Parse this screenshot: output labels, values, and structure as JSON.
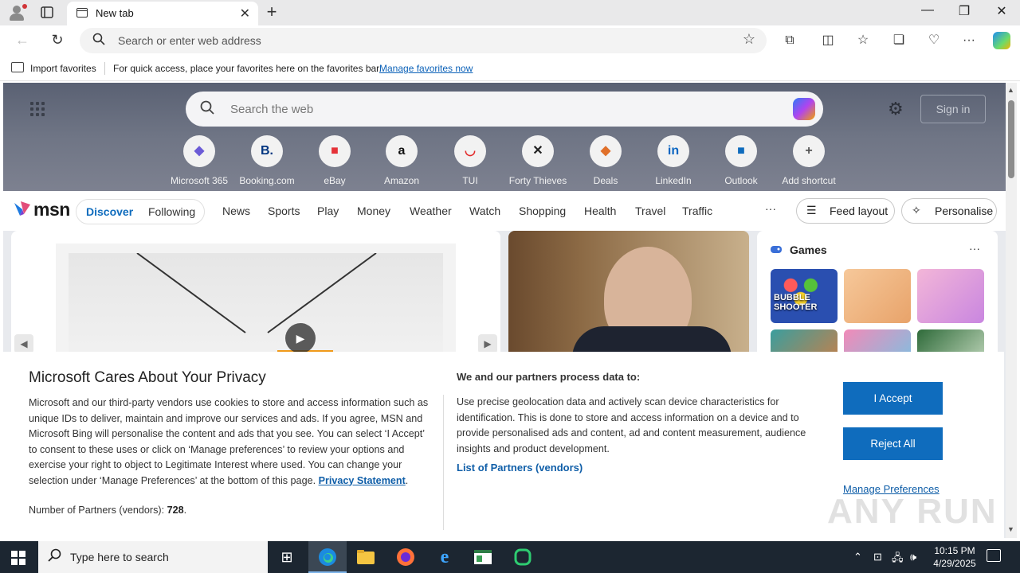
{
  "browser": {
    "tab_title": "New tab",
    "address_placeholder": "Search or enter web address",
    "favorites": {
      "import_label": "Import favorites",
      "message": "For quick access, place your favorites here on the favorites bar.",
      "manage_link": "Manage favorites now"
    }
  },
  "newtab": {
    "search_placeholder": "Search the web",
    "signin_label": "Sign in",
    "shortcuts": [
      {
        "label": "Microsoft 365",
        "icon": "microsoft-365-icon",
        "color": "#6b5bd6"
      },
      {
        "label": "Booking.com",
        "icon": "booking-icon",
        "color": "#003580"
      },
      {
        "label": "eBay",
        "icon": "ebay-icon",
        "color": "#e53238"
      },
      {
        "label": "Amazon",
        "icon": "amazon-icon",
        "color": "#111111"
      },
      {
        "label": "TUI",
        "icon": "tui-icon",
        "color": "#e32929"
      },
      {
        "label": "Forty Thieves",
        "icon": "forty-thieves-icon",
        "color": "#222222"
      },
      {
        "label": "Deals",
        "icon": "deals-icon",
        "color": "#e0702a"
      },
      {
        "label": "LinkedIn",
        "icon": "linkedin-icon",
        "color": "#0a66c2"
      },
      {
        "label": "Outlook",
        "icon": "outlook-icon",
        "color": "#0f6cbd"
      },
      {
        "label": "Add shortcut",
        "icon": "plus-icon",
        "color": "#555555"
      }
    ]
  },
  "msn": {
    "logo": "msn",
    "tabs": {
      "discover": "Discover",
      "following": "Following"
    },
    "categories": [
      "News",
      "Sports",
      "Play",
      "Money",
      "Weather",
      "Watch",
      "Shopping",
      "Health",
      "Travel",
      "Traffic"
    ],
    "more": "···",
    "feed_layout": "Feed layout",
    "personalise": "Personalise",
    "games": {
      "title": "Games",
      "more": "···",
      "tile_text": "BUBBLE SHOOTER"
    }
  },
  "privacy": {
    "title": "Microsoft Cares About Your Privacy",
    "body": "Microsoft and our third-party vendors use cookies to store and access information such as unique IDs to deliver, maintain and improve our services and ads. If you agree, MSN and Microsoft Bing will personalise the content and ads that you see. You can select ‘I Accept’ to consent to these uses or click on ‘Manage preferences’ to review your options and exercise your right to object to Legitimate Interest where used.  You can change your selection under ‘Manage Preferences’ at the bottom of this page.",
    "privacy_link": "Privacy Statement",
    "partners_label": "Number of Partners (vendors): ",
    "partners_count": "728",
    "process_title": "We and our partners process data to:",
    "process_body": "Use precise geolocation data and actively scan device characteristics for identification. This is done to store and access information on a device and to provide personalised ads and content, ad and content measurement, audience insights and product development.",
    "list_link": "List of Partners (vendors)",
    "accept": "I Accept",
    "reject": "Reject All",
    "manage": "Manage Preferences",
    "watermark": "ANY RUN"
  },
  "taskbar": {
    "search_placeholder": "Type here to search",
    "time": "10:15 PM",
    "date": "4/29/2025"
  }
}
